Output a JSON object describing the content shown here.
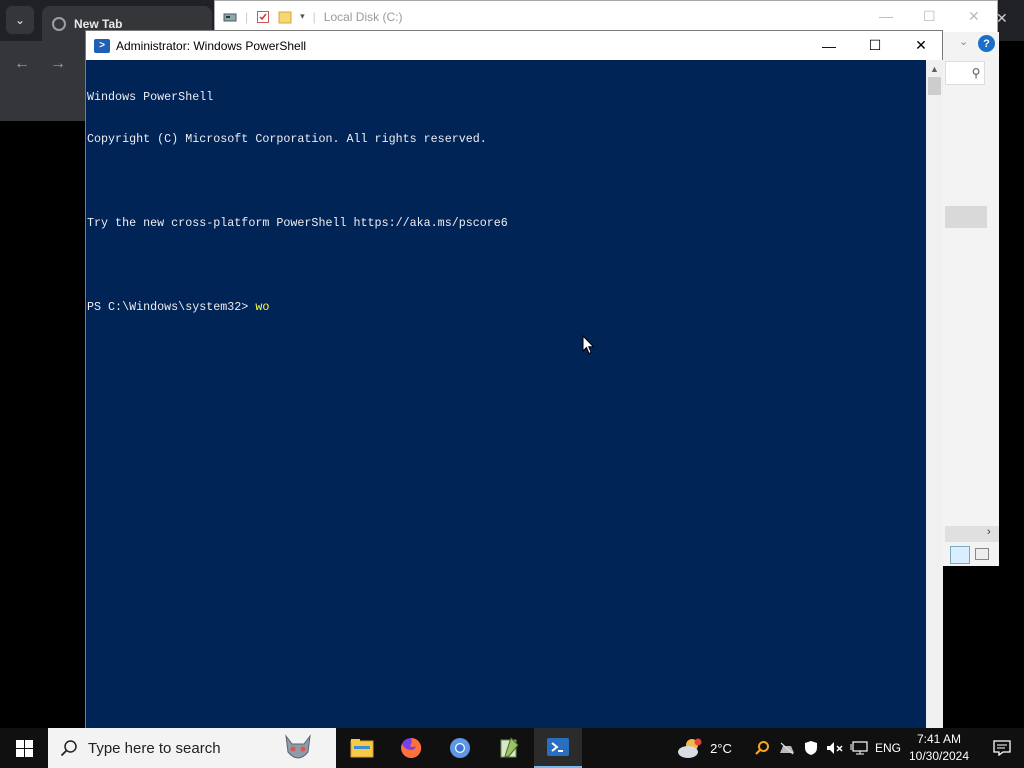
{
  "browser": {
    "tab_title": "New Tab",
    "dropdown_glyph": "⌄",
    "back_glyph": "←",
    "forward_glyph": "→",
    "close_glyph": "✕"
  },
  "explorer": {
    "title": "Local Disk (C:)",
    "minimize_glyph": "—",
    "maximize_glyph": "☐",
    "close_glyph": "✕",
    "help_glyph": "?",
    "chevron_glyph": "⌄",
    "search_glyph": "⚲",
    "scroll_right_glyph": "›"
  },
  "powershell": {
    "title": "Administrator: Windows PowerShell",
    "minimize_glyph": "—",
    "maximize_glyph": "☐",
    "close_glyph": "✕",
    "scroll_up_glyph": "▲",
    "lines": [
      "Windows PowerShell",
      "Copyright (C) Microsoft Corporation. All rights reserved.",
      "",
      "Try the new cross-platform PowerShell https://aka.ms/pscore6",
      ""
    ],
    "prompt": "PS C:\\Windows\\system32> ",
    "input": "wo"
  },
  "taskbar": {
    "search_placeholder": "Type here to search",
    "apps": [
      "file-explorer",
      "firefox",
      "chromium",
      "notepad-plus-plus",
      "powershell"
    ],
    "weather_temp": "2°C",
    "language": "ENG",
    "time": "7:41 AM",
    "date": "10/30/2024"
  },
  "colors": {
    "console_bg": "#012456",
    "console_fg": "#eeedf0",
    "console_input": "#fefe50",
    "taskbar_bg": "#101010",
    "active_indicator": "#76b9ed"
  }
}
